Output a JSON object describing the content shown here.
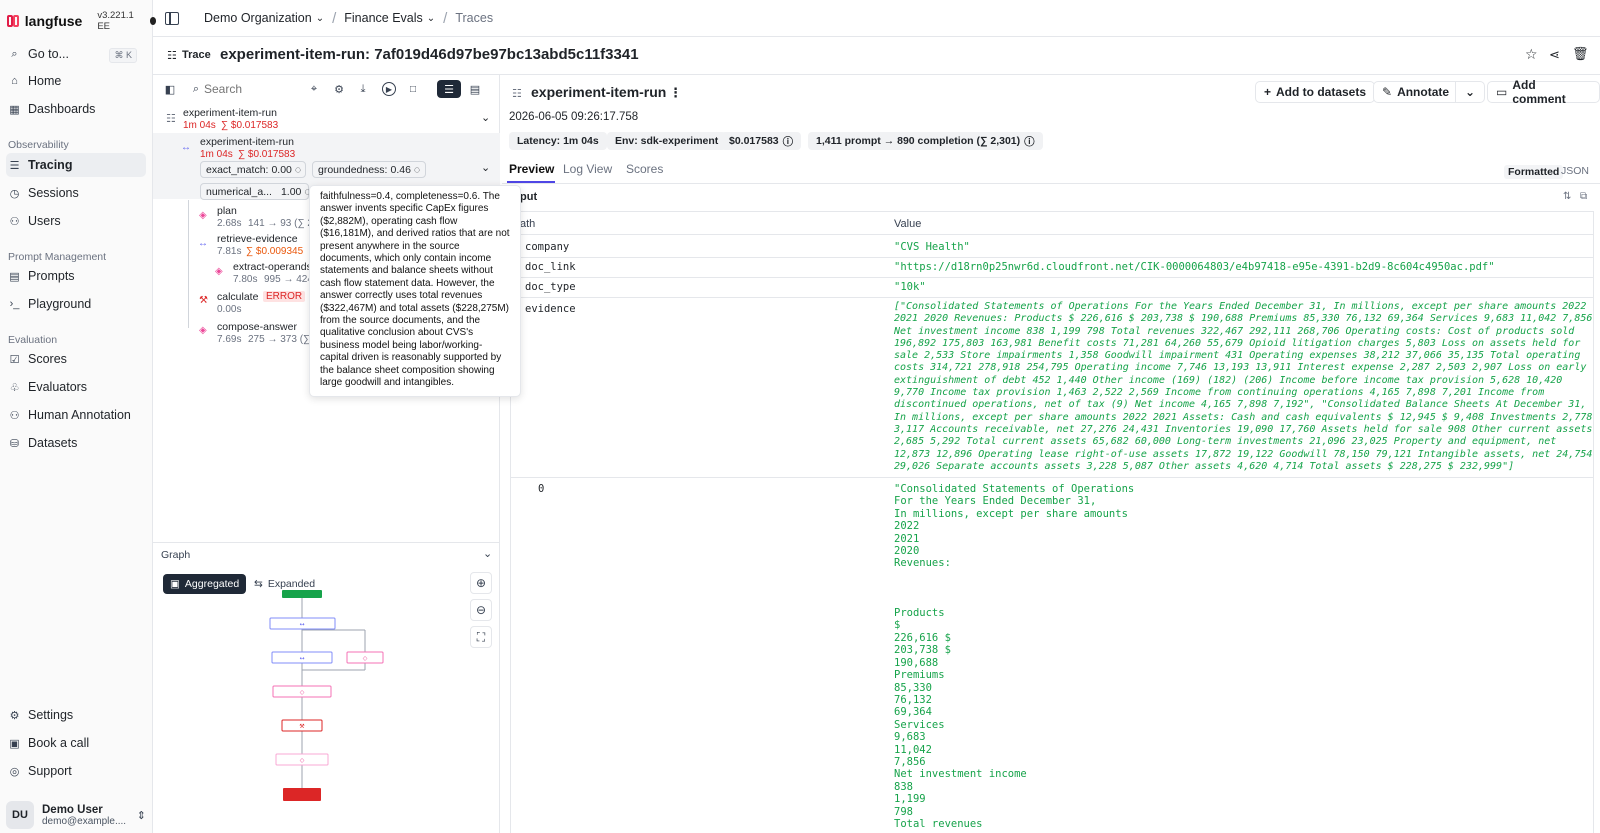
{
  "app": {
    "name": "langfuse",
    "version": "v3.221.1 EE"
  },
  "sidebar": {
    "goto": {
      "label": "Go to...",
      "shortcut": "⌘ K"
    },
    "home": "Home",
    "dashboards": "Dashboards",
    "sections": {
      "observability": "Observability",
      "prompt_management": "Prompt Management",
      "evaluation": "Evaluation"
    },
    "items": {
      "tracing": "Tracing",
      "sessions": "Sessions",
      "users": "Users",
      "prompts": "Prompts",
      "playground": "Playground",
      "scores": "Scores",
      "evaluators": "Evaluators",
      "human_annotation": "Human Annotation",
      "datasets": "Datasets",
      "settings": "Settings",
      "book_call": "Book a call",
      "support": "Support"
    },
    "user": {
      "initials": "DU",
      "name": "Demo User",
      "email": "demo@example...."
    }
  },
  "breadcrumb": {
    "org": "Demo Organization",
    "project": "Finance Evals",
    "page": "Traces"
  },
  "trace": {
    "tag": "Trace",
    "title": "experiment-item-run: 7af019d46d97be97bc13abd5c11f3341"
  },
  "tree": {
    "search_placeholder": "Search",
    "root": {
      "name": "experiment-item-run",
      "duration": "1m 04s",
      "cost": "∑ $0.017583"
    },
    "child": {
      "name": "experiment-item-run",
      "duration": "1m 04s",
      "cost": "∑ $0.017583"
    },
    "scores": {
      "exact_match": {
        "label": "exact_match:",
        "value": "0.00"
      },
      "groundedness": {
        "label": "groundedness:",
        "value": "0.46"
      },
      "numerical": {
        "label": "numerical_a...",
        "value": "1.00"
      }
    },
    "nodes": [
      {
        "name": "plan",
        "time": "2.68s",
        "tokens": "141 → 93 (∑ 2"
      },
      {
        "name": "retrieve-evidence",
        "time": "7.81s",
        "cost": "∑ $0.009345"
      },
      {
        "name": "extract-operands",
        "time": "7.80s",
        "tokens": "995 → 424"
      },
      {
        "name": "calculate",
        "status": "ERROR",
        "time": "0.00s"
      },
      {
        "name": "compose-answer",
        "time": "7.69s",
        "tokens": "275 → 373 (∑"
      }
    ]
  },
  "tooltip": {
    "text": "faithfulness=0.4, completeness=0.6. The answer invents specific CapEx figures ($2,882M), operating cash flow ($16,181M), and derived ratios that are not present anywhere in the source documents, which only contain income statements and balance sheets without cash flow statement data. However, the answer correctly uses total revenues ($322,467M) and total assets ($228,275M) from the source documents, and the qualitative conclusion about CVS's business model being labor/working-capital driven is reasonably supported by the balance sheet composition showing large goodwill and intangibles."
  },
  "graph": {
    "title": "Graph",
    "aggregated": "Aggregated",
    "expanded": "Expanded"
  },
  "detail": {
    "title": "experiment-item-run",
    "timestamp": "2026-06-05 09:26:17.758",
    "buttons": {
      "add_datasets": "Add to datasets",
      "annotate": "Annotate",
      "add_comment": "Add comment"
    },
    "badges": {
      "latency": "Latency: 1m 04s",
      "env": "Env: sdk-experiment",
      "cost": "$0.017583",
      "tokens": "1,411 prompt → 890 completion (∑ 2,301)"
    },
    "tabs": {
      "preview": "Preview",
      "log": "Log View",
      "scores": "Scores"
    },
    "format": {
      "formatted": "Formatted",
      "json": "JSON"
    },
    "section_title": "put",
    "columns": {
      "path": "ath",
      "value": "Value"
    },
    "rows": [
      {
        "key": "company",
        "value": "\"CVS Health\""
      },
      {
        "key": "doc_link",
        "value": "\"https://d18rn0p25nwr6d.cloudfront.net/CIK-0000064803/e4b97418-e95e-4391-b2d9-8c604c4950ac.pdf\""
      },
      {
        "key": "doc_type",
        "value": "\"10k\""
      },
      {
        "key": "evidence",
        "value": "[\"Consolidated Statements of Operations For the Years Ended December 31, In millions, except per share amounts 2022 2021 2020 Revenues: Products $ 226,616 $ 203,738 $ 190,688 Premiums 85,330 76,132 69,364 Services 9,683 11,042 7,856 Net investment income 838 1,199 798 Total revenues 322,467 292,111 268,706 Operating costs: Cost of products sold 196,892 175,803 163,981 Benefit costs 71,281 64,260 55,679 Opioid litigation charges 5,803 Loss on assets held for sale 2,533 Store impairments 1,358 Goodwill impairment 431 Operating expenses 38,212 37,066 35,135 Total operating costs 314,721 278,918 254,795 Operating income 7,746 13,193 13,911 Interest expense 2,287 2,503 2,907 Loss on early extinguishment of debt 452 1,440 Other income (169) (182) (206) Income before income tax provision 5,628 10,420 9,770 Income tax provision 1,463 2,522 2,569 Income from continuing operations 4,165 7,898 7,201 Income from discontinued operations, net of tax (9) Net income 4,165 7,898 7,192\", \"Consolidated Balance Sheets At December 31, In millions, except per share amounts 2022 2021 Assets: Cash and cash equivalents $ 12,945 $ 9,408 Investments 2,778 3,117 Accounts receivable, net 27,276 24,431 Inventories 19,090 17,760 Assets held for sale 908 Other current assets 2,685 5,292 Total current assets 65,682 60,000 Long-term investments 21,096 23,025 Property and equipment, net 12,873 12,896 Operating lease right-of-use assets 17,872 19,122 Goodwill 78,150 79,121 Intangible assets, net 24,754 29,026 Separate accounts assets 3,228 5,087 Other assets 4,620 4,714 Total assets $ 228,275 $ 232,999\"]"
      },
      {
        "key": "0",
        "value": "\"Consolidated Statements of Operations\nFor the Years Ended December 31,\nIn millions, except per share amounts\n2022\n2021\n2020\nRevenues:\n\n\n\nProducts\n$\n226,616 $\n203,738 $\n190,688\nPremiums\n85,330\n76,132\n69,364\nServices\n9,683\n11,042\n7,856\nNet investment income\n838\n1,199\n798\nTotal revenues"
      }
    ]
  },
  "colors": {
    "accent": "#2563eb",
    "error": "#dc2626",
    "success": "#16a34a",
    "graph_green": "#16a34a",
    "graph_red": "#dc2626"
  }
}
